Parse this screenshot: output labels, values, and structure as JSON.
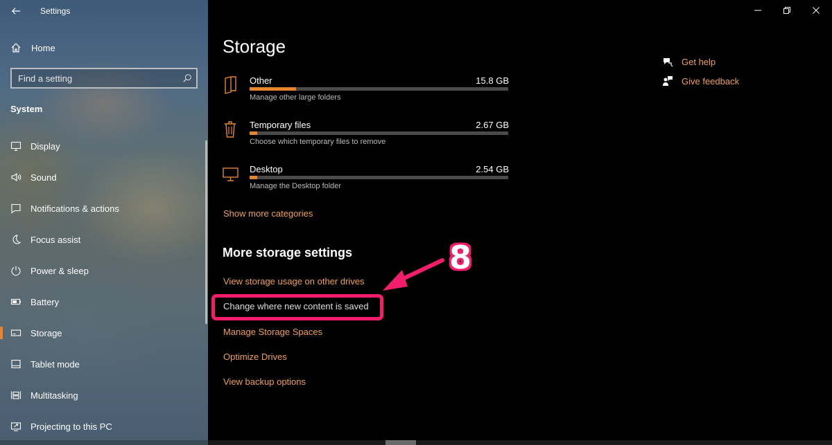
{
  "window": {
    "title": "Settings",
    "minimize_icon": "minimize-icon",
    "maximize_icon": "restore-icon",
    "close_icon": "close-icon"
  },
  "sidebar": {
    "home_label": "Home",
    "search_placeholder": "Find a setting",
    "section_heading": "System",
    "items": [
      {
        "label": "Display",
        "icon": "display-icon"
      },
      {
        "label": "Sound",
        "icon": "sound-icon"
      },
      {
        "label": "Notifications & actions",
        "icon": "notifications-icon"
      },
      {
        "label": "Focus assist",
        "icon": "focus-assist-icon"
      },
      {
        "label": "Power & sleep",
        "icon": "power-icon"
      },
      {
        "label": "Battery",
        "icon": "battery-icon"
      },
      {
        "label": "Storage",
        "icon": "storage-icon",
        "selected": true
      },
      {
        "label": "Tablet mode",
        "icon": "tablet-icon"
      },
      {
        "label": "Multitasking",
        "icon": "multitasking-icon"
      },
      {
        "label": "Projecting to this PC",
        "icon": "projecting-icon"
      }
    ]
  },
  "main": {
    "title": "Storage",
    "categories": [
      {
        "name": "Other",
        "size": "15.8 GB",
        "description": "Manage other large folders",
        "usage_fraction": 0.18,
        "icon": "folder-icon"
      },
      {
        "name": "Temporary files",
        "size": "2.67 GB",
        "description": "Choose which temporary files to remove",
        "usage_fraction": 0.03,
        "icon": "trash-icon"
      },
      {
        "name": "Desktop",
        "size": "2.54 GB",
        "description": "Manage the Desktop folder",
        "usage_fraction": 0.03,
        "icon": "monitor-icon"
      }
    ],
    "show_more": "Show more categories",
    "more_settings_title": "More storage settings",
    "links": {
      "other_drives": "View storage usage on other drives",
      "new_content": "Change where new content is saved",
      "storage_spaces": "Manage Storage Spaces",
      "optimize": "Optimize Drives",
      "backup": "View backup options"
    },
    "annotation_number": "8"
  },
  "right_panel": {
    "get_help": "Get help",
    "give_feedback": "Give feedback"
  },
  "colors": {
    "accent": "#e6852e",
    "link": "#f0a050",
    "annotation": "#f21e6c",
    "background": "#000000"
  }
}
